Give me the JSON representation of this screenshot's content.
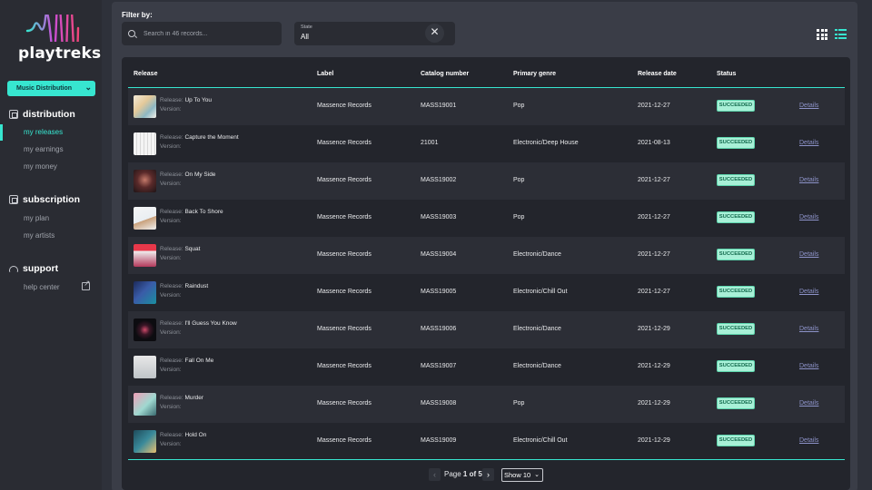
{
  "app": {
    "logo_text": "playtreks",
    "product_select": "Music Distribution"
  },
  "sidebar": {
    "sections": [
      {
        "label": "distribution",
        "icon": "distribution-icon"
      },
      {
        "label": "subscription",
        "icon": "subscription-icon"
      },
      {
        "label": "support",
        "icon": "headset-icon"
      }
    ],
    "items": [
      {
        "label": "my releases",
        "active": true
      },
      {
        "label": "my earnings"
      },
      {
        "label": "my money"
      },
      {
        "label": "my plan"
      },
      {
        "label": "my artists"
      },
      {
        "label": "help center"
      }
    ]
  },
  "filter": {
    "label": "Filter by:",
    "search_placeholder": "Search in 46 records...",
    "state_label": "State",
    "state_value": "All",
    "clear_icon": "close-icon"
  },
  "table": {
    "columns": [
      "Release",
      "Label",
      "Catalog number",
      "Primary genre",
      "Release date",
      "Status"
    ],
    "release_prefix": "Release:",
    "version_prefix": "Version:",
    "details_label": "Details",
    "rows": [
      {
        "release": "Up To You",
        "label": "Massence Records",
        "catalog": "MASS19001",
        "genre": "Pop",
        "date": "2021-12-27",
        "status": "SUCCEEDED"
      },
      {
        "release": "Capture the Moment",
        "label": "Massence Records",
        "catalog": "21001",
        "genre": "Electronic/Deep House",
        "date": "2021-08-13",
        "status": "SUCCEEDED"
      },
      {
        "release": "On My Side",
        "label": "Massence Records",
        "catalog": "MASS19002",
        "genre": "Pop",
        "date": "2021-12-27",
        "status": "SUCCEEDED"
      },
      {
        "release": "Back To Shore",
        "label": "Massence Records",
        "catalog": "MASS19003",
        "genre": "Pop",
        "date": "2021-12-27",
        "status": "SUCCEEDED"
      },
      {
        "release": "Squat",
        "label": "Massence Records",
        "catalog": "MASS19004",
        "genre": "Electronic/Dance",
        "date": "2021-12-27",
        "status": "SUCCEEDED"
      },
      {
        "release": "Raindust",
        "label": "Massence Records",
        "catalog": "MASS19005",
        "genre": "Electronic/Chill Out",
        "date": "2021-12-27",
        "status": "SUCCEEDED"
      },
      {
        "release": "I'll Guess You Know",
        "label": "Massence Records",
        "catalog": "MASS19006",
        "genre": "Electronic/Dance",
        "date": "2021-12-29",
        "status": "SUCCEEDED"
      },
      {
        "release": "Fall On Me",
        "label": "Massence Records",
        "catalog": "MASS19007",
        "genre": "Electronic/Dance",
        "date": "2021-12-29",
        "status": "SUCCEEDED"
      },
      {
        "release": "Murder",
        "label": "Massence Records",
        "catalog": "MASS19008",
        "genre": "Pop",
        "date": "2021-12-29",
        "status": "SUCCEEDED"
      },
      {
        "release": "Hold On",
        "label": "Massence Records",
        "catalog": "MASS19009",
        "genre": "Electronic/Chill Out",
        "date": "2021-12-29",
        "status": "SUCCEEDED"
      }
    ]
  },
  "pagination": {
    "page_prefix": "Page",
    "page_current": "1 of 5",
    "show_value": "Show 10"
  },
  "colors": {
    "accent": "#37e6d0",
    "badge_bg": "#a8f0d7",
    "badge_text": "#136a4d",
    "link": "#8d93c9"
  }
}
